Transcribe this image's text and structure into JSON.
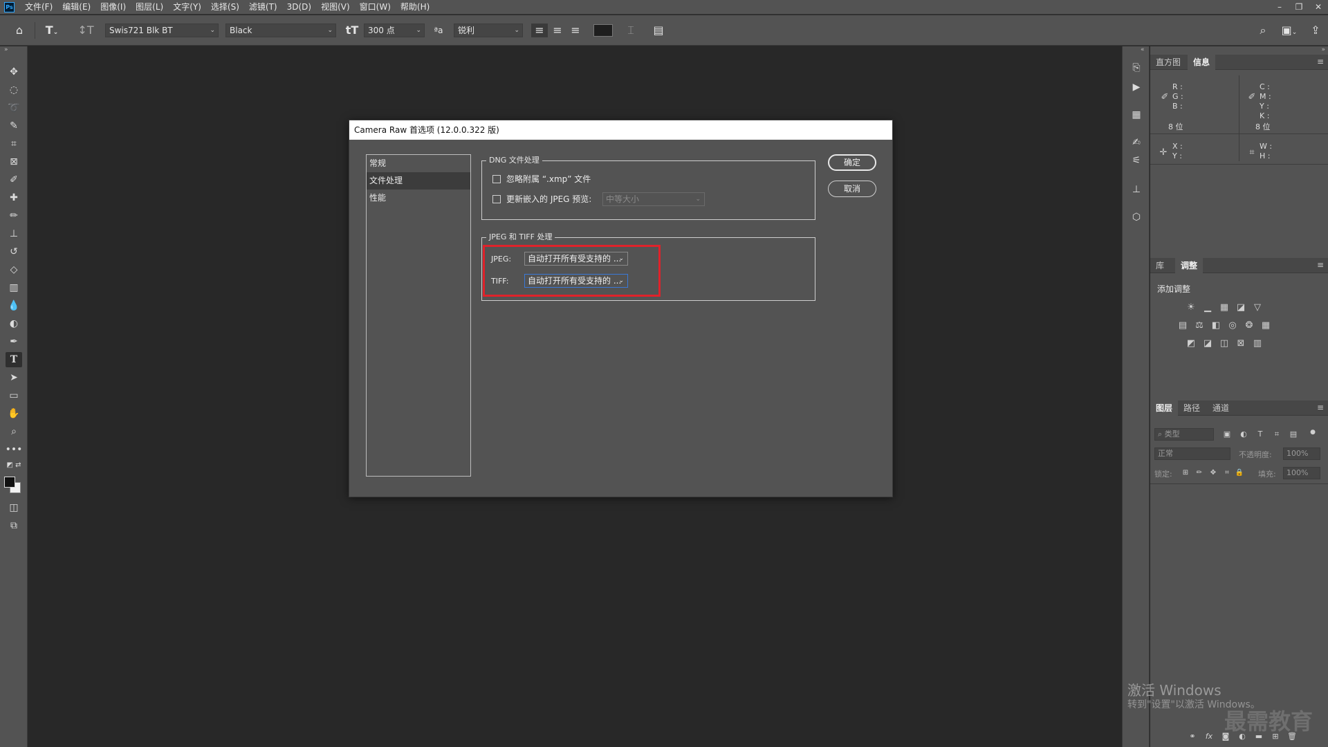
{
  "menubar": {
    "logo": "Ps",
    "items": [
      "文件(F)",
      "编辑(E)",
      "图像(I)",
      "图层(L)",
      "文字(Y)",
      "选择(S)",
      "滤镜(T)",
      "3D(D)",
      "视图(V)",
      "窗口(W)",
      "帮助(H)"
    ],
    "window_controls": [
      "–",
      "❐",
      "✕"
    ]
  },
  "optbar": {
    "font_family": "Swis721 Blk BT",
    "font_style": "Black",
    "font_size": "300 点",
    "anti_alias": "锐利"
  },
  "panels": {
    "top_tabs": [
      "直方图",
      "信息"
    ],
    "info": {
      "rgb_labels": [
        "R :",
        "G :",
        "B :"
      ],
      "cmyk_labels": [
        "C :",
        "M :",
        "Y :",
        "K :"
      ],
      "bit_left": "8 位",
      "bit_right": "8 位",
      "xy_labels": [
        "X :",
        "Y :"
      ],
      "wh_labels": [
        "W :",
        "H :"
      ]
    },
    "mid_tabs": [
      "库",
      "调整"
    ],
    "add_adjustment": "添加调整",
    "layer_tabs": [
      "图层",
      "路径",
      "通道"
    ],
    "layer_search_placeholder": "类型",
    "blend_mode": "正常",
    "opacity_label": "不透明度:",
    "opacity_value": "100%",
    "lock_label": "锁定:",
    "fill_label": "填充:",
    "fill_value": "100%"
  },
  "watermark": {
    "activate": "激活 Windows",
    "activate_hint": "转到\"设置\"以激活 Windows。",
    "brand": "最需教育"
  },
  "dialog": {
    "title": "Camera Raw 首选项 (12.0.0.322 版)",
    "categories": [
      "常规",
      "文件处理",
      "性能"
    ],
    "selected_category": "文件处理",
    "dng_group": {
      "title": "DNG 文件处理",
      "ignore_xmp_label": "忽略附属 “.xmp” 文件",
      "update_jpeg_label": "更新嵌入的 JPEG 预览:",
      "preview_size": "中等大小"
    },
    "jpeg_tiff_group": {
      "title": "JPEG 和 TIFF 处理",
      "jpeg_label": "JPEG:",
      "jpeg_value": "自动打开所有受支持的 ...",
      "tiff_label": "TIFF:",
      "tiff_value": "自动打开所有受支持的 ..."
    },
    "ok_label": "确定",
    "cancel_label": "取消"
  }
}
